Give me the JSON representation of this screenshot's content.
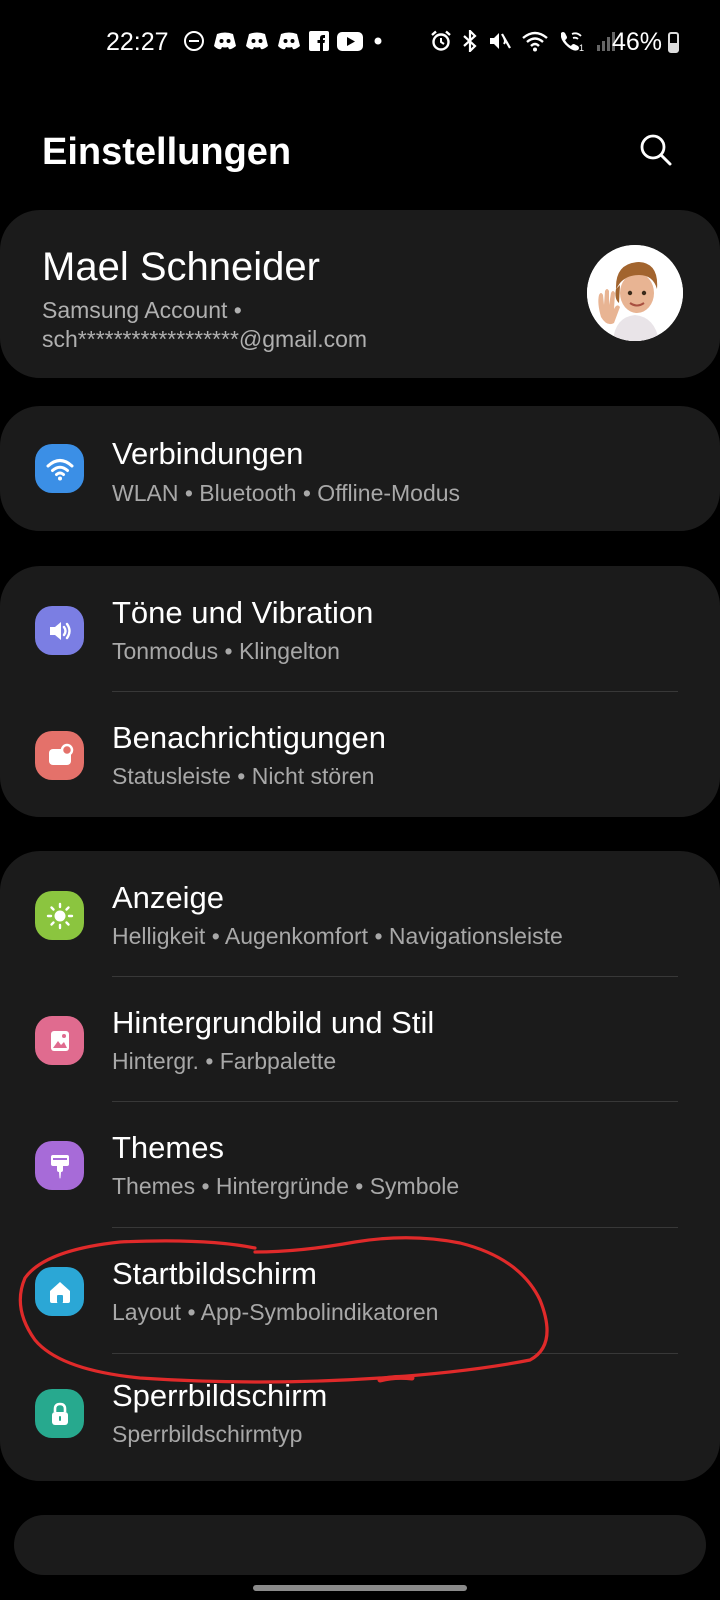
{
  "status_bar": {
    "time": "22:27",
    "battery": "46%",
    "battery_level": 0.46,
    "left_icons": [
      "do-not-disturb-icon",
      "discord-icon",
      "discord-icon",
      "discord-icon",
      "facebook-icon",
      "youtube-icon",
      "dot-icon"
    ],
    "right_icons": [
      "alarm-icon",
      "bluetooth-icon",
      "mute-vibrate-icon",
      "wifi-icon",
      "wifi-calling-icon",
      "signal-icon"
    ]
  },
  "header": {
    "title": "Einstellungen",
    "search_icon": "search-icon"
  },
  "account": {
    "name": "Mael Schneider",
    "subtitle_line1": "Samsung Account  •",
    "subtitle_line2": "sch******************@gmail.com",
    "avatar_icon": "avatar-icon"
  },
  "groups": [
    {
      "items": [
        {
          "title": "Verbindungen",
          "subtitle": "WLAN  •  Bluetooth  •  Offline-Modus",
          "icon": "wifi-icon",
          "color": "#3b8fe6"
        }
      ]
    },
    {
      "items": [
        {
          "title": "Töne und Vibration",
          "subtitle": "Tonmodus  •  Klingelton",
          "icon": "speaker-icon",
          "color": "#7b7ee3"
        },
        {
          "title": "Benachrichtigungen",
          "subtitle": "Statusleiste  •  Nicht stören",
          "icon": "notification-icon",
          "color": "#e4716a"
        }
      ]
    },
    {
      "items": [
        {
          "title": "Anzeige",
          "subtitle": "Helligkeit  •  Augenkomfort  •  Navigationsleiste",
          "icon": "sun-icon",
          "color": "#8bc53f"
        },
        {
          "title": "Hintergrundbild und Stil",
          "subtitle": "Hintergr.  •  Farbpalette",
          "icon": "image-icon",
          "color": "#e06b8f"
        },
        {
          "title": "Themes",
          "subtitle": "Themes  •  Hintergründe  •  Symbole",
          "icon": "brush-icon",
          "color": "#a76bd8"
        },
        {
          "title": "Startbildschirm",
          "subtitle": "Layout  •  App-Symbolindikatoren",
          "icon": "home-icon",
          "color": "#2ba7d6"
        },
        {
          "title": "Sperrbildschirm",
          "subtitle": "Sperrbildschirmtyp",
          "icon": "lock-icon",
          "color": "#27a98e"
        }
      ]
    }
  ],
  "colors": {
    "annotation": "#e02a2a",
    "card": "#1b1b1b",
    "background": "#000000"
  }
}
